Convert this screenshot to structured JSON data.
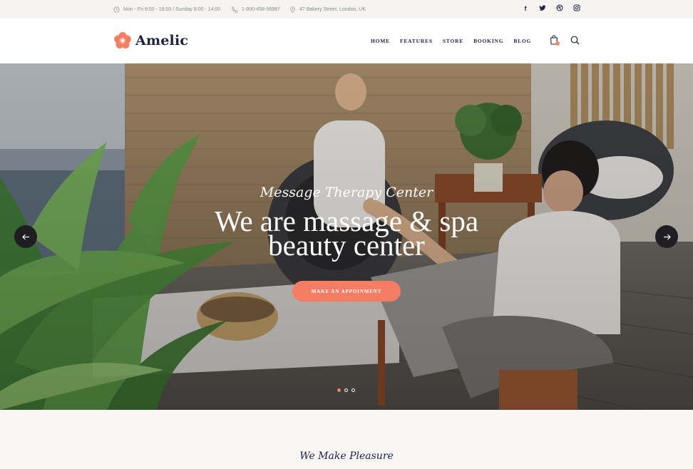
{
  "topbar": {
    "hours": "Mon - Fri 8:00 - 18:00  /  Sunday 8:00 - 14:00",
    "phone": "1-800-458-56987",
    "address": "47 Bakery Street, London, UK",
    "social_icons": [
      "facebook-icon",
      "twitter-icon",
      "dribbble-icon",
      "instagram-icon"
    ]
  },
  "header": {
    "logo_text": "Amelic",
    "nav": [
      "HOME",
      "FEATURES",
      "STORE",
      "BOOKING",
      "BLOG"
    ]
  },
  "hero": {
    "subtitle": "Message Therapy Center",
    "title_line1": "We are massage & spa",
    "title_line2": "beauty center",
    "cta": "MAKE AN APPOINMENT",
    "slides": 3,
    "active_slide": 1
  },
  "section": {
    "subtitle": "We Make Pleasure"
  },
  "colors": {
    "accent": "#f47d63",
    "navy": "#1f2340",
    "topbar_bg": "#f5f4f2"
  }
}
